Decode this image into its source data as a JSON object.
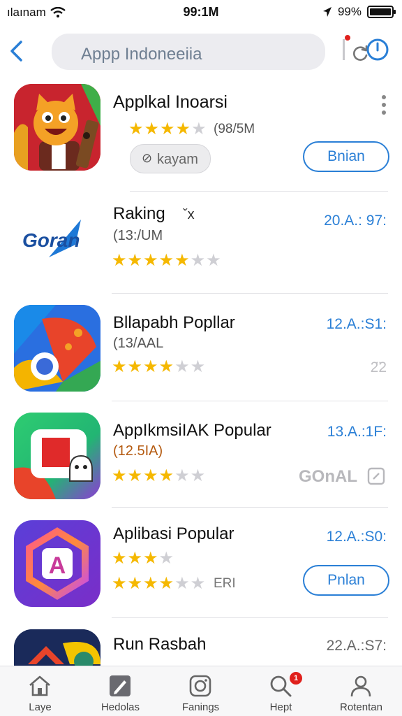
{
  "status_bar": {
    "carrier": "ılaınam",
    "time": "99:1M",
    "battery": "99%",
    "battery_level": 0.99
  },
  "header": {
    "search_text": "Appp Indoneeiia"
  },
  "apps": [
    {
      "title": "Applkal Inoarsi",
      "rating_text": "(98/5M",
      "stars_full": 4,
      "stars_total": 5,
      "chip_label": "kayam",
      "button_label": "Bnian"
    },
    {
      "title": "Raking",
      "title_suffix": "ˇx",
      "logo_text": "Goran",
      "subtitle": "(13:/UM",
      "stars_full": 4,
      "stars_total": 6,
      "side_text": "20.A.: 97:"
    },
    {
      "title": "Bllapabh Popllar",
      "subtitle": "(13/AAL",
      "stars_full": 4,
      "stars_total": 6,
      "side_text": "12.A.:S1:",
      "side_sub": "2̈2"
    },
    {
      "title": "AppIkmsiIAK Popular",
      "subtitle": "(12.5IA)",
      "stars_full": 4,
      "stars_total": 6,
      "side_text": "13.A.:1F:",
      "side_sub": "GOnAL"
    },
    {
      "title": "Aplibasi Popular",
      "stars_top_full": 3,
      "stars_top_total": 4,
      "stars_full": 4,
      "stars_total": 6,
      "stars_suffix": "ERI",
      "side_text": "12.A.:S0:",
      "button_label": "Pnlan"
    },
    {
      "title": "Run Rasbah",
      "side_text": "22.A.:S7:"
    }
  ],
  "tabs": [
    {
      "label": "Laye",
      "icon": "home-icon"
    },
    {
      "label": "Hedolas",
      "icon": "edit-icon"
    },
    {
      "label": "Fanings",
      "icon": "camera-icon"
    },
    {
      "label": "Hept",
      "icon": "search-icon",
      "badge": "1"
    },
    {
      "label": "Rotentan",
      "icon": "person-icon"
    }
  ],
  "colors": {
    "accent": "#2a7fd6",
    "star": "#f5b800",
    "badge": "#e0201c"
  }
}
